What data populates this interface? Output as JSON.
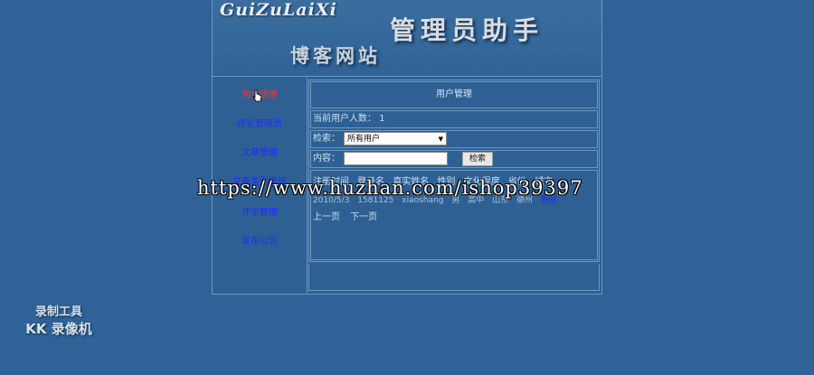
{
  "banner": {
    "brand_script": "GuiZuLaiXi",
    "app_title": "管理员助手",
    "site_name": "博客网站"
  },
  "sidebar": {
    "items": [
      {
        "label": "用户管理",
        "active": true
      },
      {
        "label": "评论管理员",
        "active": false
      },
      {
        "label": "文章管理",
        "active": false
      },
      {
        "label": "文章类别管理",
        "active": false
      },
      {
        "label": "评论管理",
        "active": false
      },
      {
        "label": "发布公告",
        "active": false
      }
    ]
  },
  "main": {
    "title": "用户管理",
    "count_label": "当前用户人数：",
    "count_value": "1",
    "filter": {
      "label": "检索：",
      "selected": "所有用户"
    },
    "search": {
      "label": "内容：",
      "value": "",
      "button": "检索"
    },
    "table": {
      "headers": [
        "注册时间",
        "登录名",
        "真实姓名",
        "性别",
        "文化程度",
        "省份",
        "城市"
      ],
      "rows": [
        {
          "cells": [
            "2010/5/3",
            "1581125",
            "xiaoshang",
            "男",
            "高中",
            "山东",
            "德州"
          ],
          "action": "删除"
        }
      ]
    },
    "pager": {
      "prev": "上一页",
      "next": "下一页"
    }
  },
  "overlay": {
    "watermark_url": "https://www.huzhan.com/ishop39397",
    "recorder_line1": "录制工具",
    "recorder_line2": "KK 录像机"
  },
  "colors": {
    "background": "#2f6397",
    "nav_link": "#1d2cff",
    "nav_active": "#e23a3a",
    "border": "#6f97c0"
  }
}
